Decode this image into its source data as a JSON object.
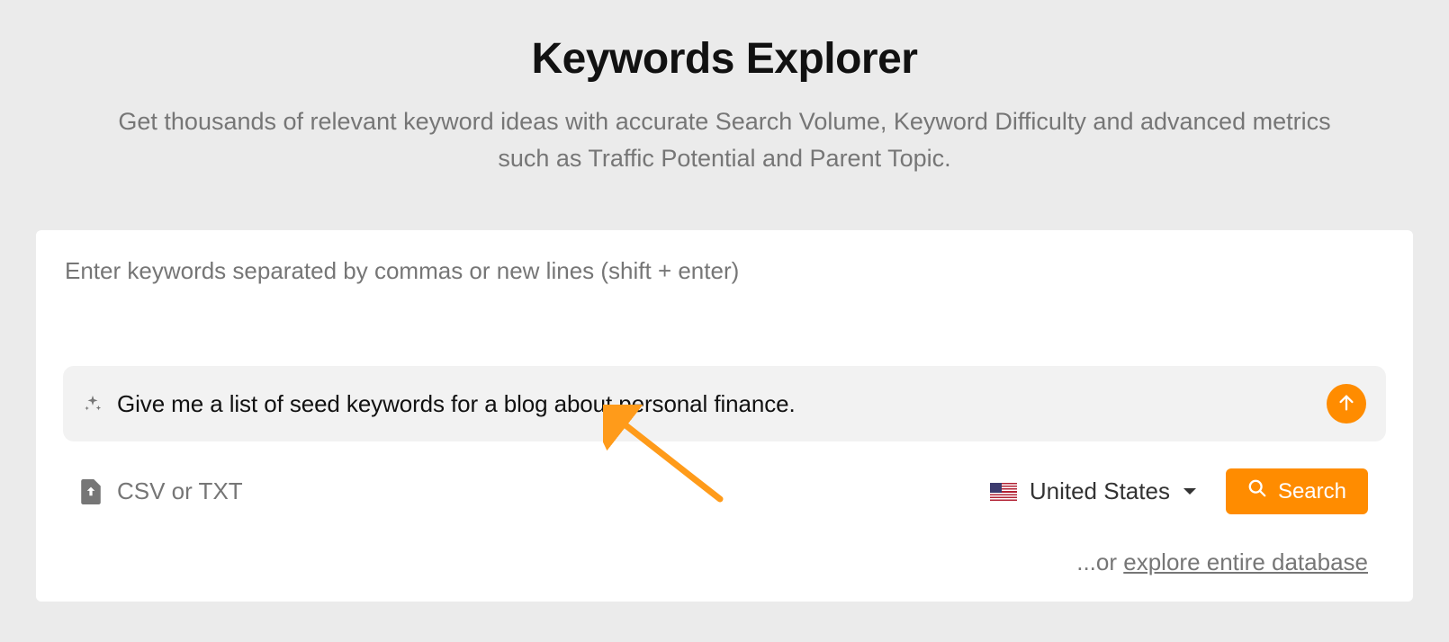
{
  "header": {
    "title": "Keywords Explorer",
    "subtitle": "Get thousands of relevant keyword ideas with accurate Search Volume, Keyword Difficulty and advanced metrics such as Traffic Potential and Parent Topic."
  },
  "input": {
    "placeholder": "Enter keywords separated by commas or new lines (shift + enter)",
    "ai_prompt": "Give me a list of seed keywords for a blog about personal finance."
  },
  "controls": {
    "file_label": "CSV or TXT",
    "country": "United States",
    "search_label": "Search",
    "explore_prefix": "...or ",
    "explore_link": "explore entire database"
  }
}
